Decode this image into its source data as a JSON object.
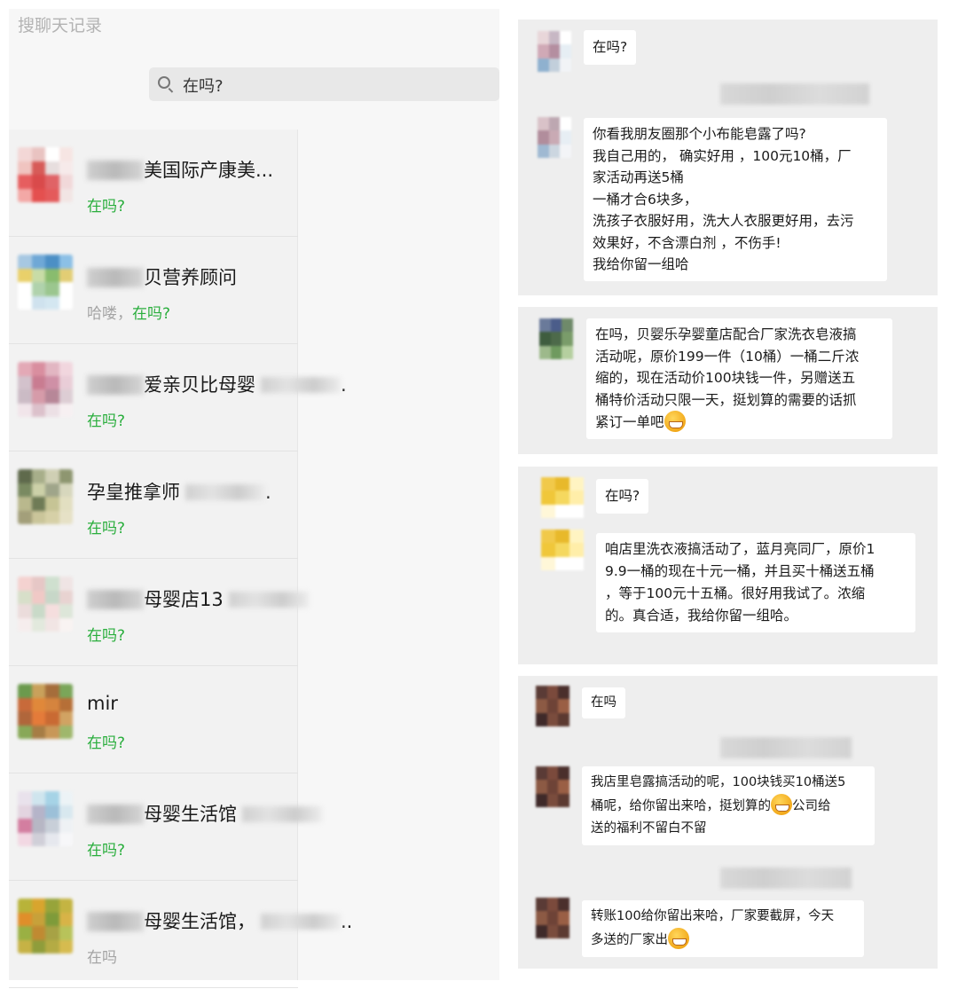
{
  "left_panel": {
    "title": "搜聊天记录",
    "search": {
      "value": "在吗?"
    },
    "items": [
      {
        "name": "美国际产康美...",
        "name_tail": "",
        "sub_grey": "",
        "sub_green": "在吗?",
        "avatar": [
          "#f3d7d6",
          "#e9c3c1",
          "#ffffff",
          "#f6e5e3",
          "#f0c4c0",
          "#d75b58",
          "#e7dede",
          "#f6eaea",
          "#e65e5f",
          "#d94a4b",
          "#e06366",
          "#f1d8d9",
          "#f3a8a6",
          "#e4504f",
          "#e45a5b",
          "#f2e5e4"
        ]
      },
      {
        "name": "贝营养顾问",
        "name_tail": "",
        "sub_grey": "哈喽，",
        "sub_green": "在吗?",
        "avatar": [
          "#a7c8e2",
          "#6fa8d6",
          "#4c8fc5",
          "#8cc0e6",
          "#e9d06a",
          "#c8dca6",
          "#89bc6e",
          "#e2cd74",
          "#ffffff",
          "#b0d2ac",
          "#9bc68f",
          "#ffffff",
          "#ffffff",
          "#cfe2ee",
          "#d4e7f1",
          "#ffffff"
        ]
      },
      {
        "name": "爱亲贝比母婴",
        "name_tail": ".",
        "sub_grey": "",
        "sub_green": "在吗?",
        "avatar": [
          "#e3a9b6",
          "#d98e9f",
          "#e2b6c2",
          "#f1d6de",
          "#d3c2cc",
          "#c97c91",
          "#cf90a6",
          "#e9cdd7",
          "#cbbbc5",
          "#d69ba9",
          "#b78798",
          "#ddcdd4",
          "#f1e5ea",
          "#dcc1cb",
          "#ece0e5",
          "#f7f0f2"
        ]
      },
      {
        "name": "孕皇推拿师",
        "name_tail": ".",
        "sub_grey": "",
        "sub_green": "在吗?",
        "avatar": [
          "#5f6a4c",
          "#a7ae8a",
          "#cfcfb4",
          "#8e9670",
          "#7a8a61",
          "#ccd0a8",
          "#9fa58a",
          "#d7d7bd",
          "#b9b88d",
          "#6f7b56",
          "#c6c495",
          "#e2dfc1",
          "#a39f7a",
          "#cac59a",
          "#d6d0a7",
          "#e6e1c6"
        ]
      },
      {
        "name": "母婴店13",
        "name_tail": "",
        "sub_grey": "",
        "sub_green": "在吗?",
        "avatar": [
          "#f4d2d0",
          "#e6c7c6",
          "#cfe0cf",
          "#efe4e4",
          "#d7dfc9",
          "#f0c9c6",
          "#c7d7c8",
          "#e8d3d1",
          "#ebdcdb",
          "#c9dac8",
          "#f5dede",
          "#dde6d9",
          "#f6eded",
          "#e2e9dd",
          "#f1e5e4",
          "#f9f3f2"
        ]
      },
      {
        "name": "mir",
        "name_tail": "",
        "sub_grey": "",
        "sub_green": "在吗?",
        "avatar": [
          "#6b9a4d",
          "#c9a15b",
          "#a56d3b",
          "#7aa659",
          "#c86a3a",
          "#e0883a",
          "#d5843e",
          "#b66f37",
          "#b0663b",
          "#e47b3a",
          "#c96a33",
          "#d1a363",
          "#88a858",
          "#a67d45",
          "#c89758",
          "#9fb76c"
        ]
      },
      {
        "name": "母婴生活馆",
        "name_tail": "",
        "sub_grey": "",
        "sub_green": "在吗?",
        "avatar": [
          "#e9e2ec",
          "#cfe5ee",
          "#a6d3e6",
          "#ecf3f6",
          "#e3d4e0",
          "#b5b4c9",
          "#9cc0d8",
          "#d8e8ef",
          "#d37ea0",
          "#b7b7c4",
          "#c8cfd8",
          "#eef1f4",
          "#f2d8e3",
          "#d0cfd8",
          "#e6e8ee",
          "#f7f7f9"
        ]
      },
      {
        "name": "母婴生活馆，",
        "name_tail": "..",
        "sub_grey": "在吗",
        "sub_green": "",
        "avatar": [
          "#b8b339",
          "#d8a52e",
          "#97a43a",
          "#c4b442",
          "#e08e2a",
          "#c7a13a",
          "#7e9b3a",
          "#d8b347",
          "#9ab043",
          "#c08a32",
          "#a7a245",
          "#b8c35a",
          "#c6b245",
          "#8f9d3b",
          "#b4ab44",
          "#d6bb4f"
        ]
      }
    ]
  },
  "right_panel": {
    "cards": [
      {
        "messages": [
          {
            "text": "在吗?"
          },
          {
            "text": "你看我朋友圈那个小布能皂露了吗?\n我自己用的， 确实好用 ，100元10桶，厂\n家活动再送5桶\n一桶才合6块多，\n洗孩子衣服好用，洗大人衣服更好用，去污\n效果好，不含漂白剂 ，不伤手!\n我给你留一组哈"
          }
        ]
      },
      {
        "messages": [
          {
            "text": "在吗，贝婴乐孕婴童店配合厂家洗衣皂液搞\n活动呢，原价199一件（10桶）一桶二斤浓\n缩的，现在活动价100块钱一件，另赠送五\n桶特价活动只限一天，挺划算的需要的话抓\n紧订一单吧"
          }
        ]
      },
      {
        "messages": [
          {
            "text": "在吗?"
          },
          {
            "text": "咱店里洗衣液搞活动了，蓝月亮同厂，原价1\n9.9一桶的现在十元一桶，并且买十桶送五桶\n，等于100元十五桶。很好用我试了。浓缩\n的。真合适，我给你留一组哈。"
          }
        ]
      },
      {
        "messages": [
          {
            "text": "在吗"
          },
          {
            "text_a": "我店里皂露搞活动的呢，100块钱买10桶送5\n桶呢，给你留出来哈，挺划算的",
            "text_b": "公司给\n送的福利不留白不留"
          },
          {
            "text": "转账100给你留出来哈，厂家要截屏，今天\n多送的厂家出"
          }
        ]
      }
    ]
  },
  "colors": {
    "accent_green": "#2aae3d",
    "panel_bg": "#eeeeee",
    "list_bg": "#f2f2f2"
  }
}
